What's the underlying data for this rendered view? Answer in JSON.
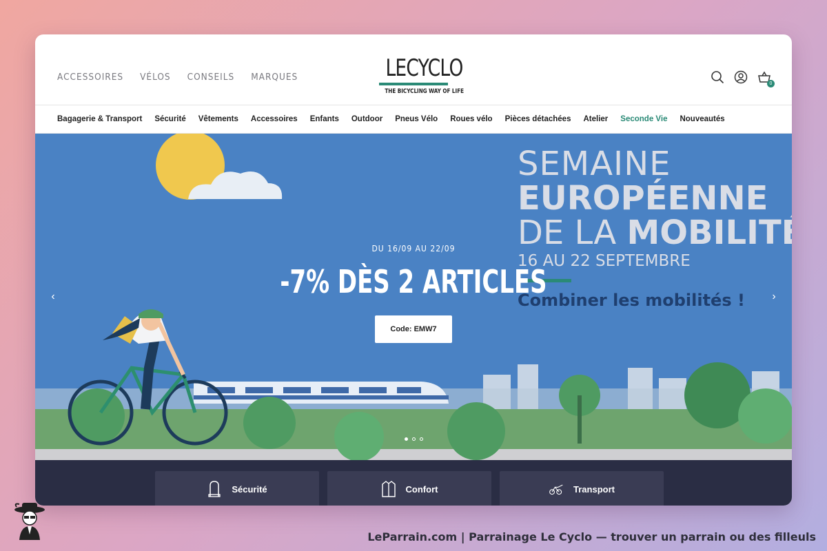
{
  "header": {
    "topnav": [
      "ACCESSOIRES",
      "VÉLOS",
      "CONSEILS",
      "MARQUES"
    ],
    "logo_word": "LECYCLO",
    "logo_tagline": "THE BICYCLING WAY OF LIFE",
    "cart_count": "0"
  },
  "catnav": [
    "Bagagerie & Transport",
    "Sécurité",
    "Vêtements",
    "Accessoires",
    "Enfants",
    "Outdoor",
    "Pneus Vélo",
    "Roues vélo",
    "Pièces détachées",
    "Atelier",
    "Seconde Vie",
    "Nouveautés"
  ],
  "hero": {
    "kicker": "DU 16/09 AU 22/09",
    "title": "-7% DÈS 2 ARTICLES",
    "code_button": "Code: EMW7",
    "banner_line1": "SEMAINE",
    "banner_line2": "EUROPÉENNE",
    "banner_line3a": "DE LA ",
    "banner_line3b": "MOBILITÉ",
    "banner_dates": "16 AU 22 SEPTEMBRE",
    "banner_slogan": "Combiner les mobilités !",
    "arrow_left": "‹",
    "arrow_right": "›",
    "slide_count": 3,
    "active_slide": 1
  },
  "strip": {
    "cards": [
      "Sécurité",
      "Confort",
      "Transport"
    ]
  },
  "footer": {
    "text": "LeParrain.com | Parrainage Le Cyclo — trouver un parrain ou des filleuls"
  },
  "colors": {
    "accent": "#2a8a76",
    "hero_bg": "#4a82c4",
    "strip_bg": "#2a2d44"
  }
}
